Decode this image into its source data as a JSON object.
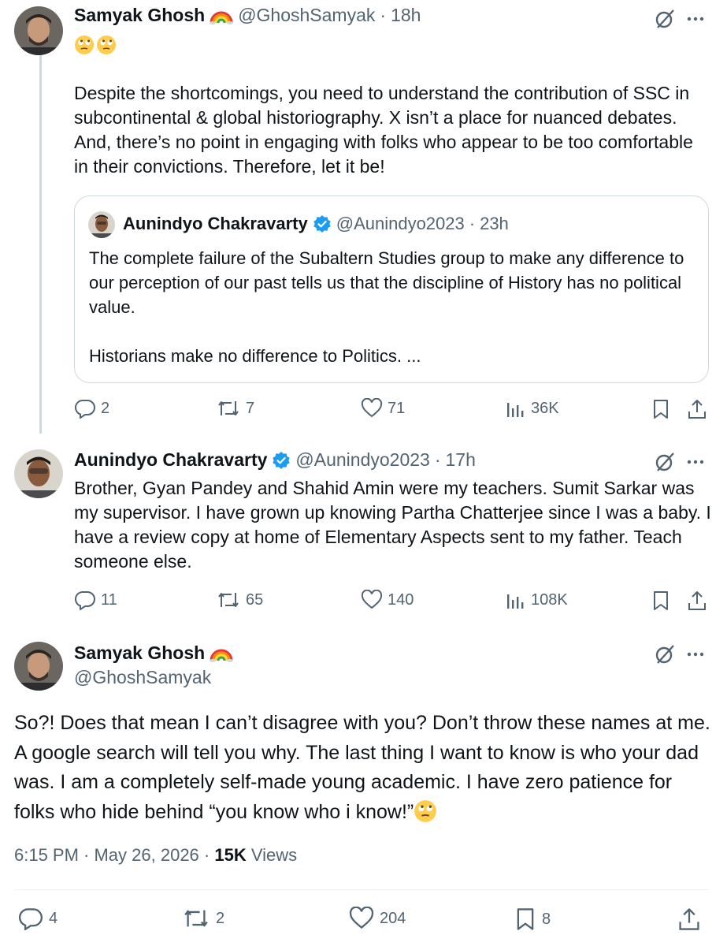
{
  "tweet1": {
    "name": "Samyak Ghosh",
    "handle": "@GhoshSamyak",
    "dot": "·",
    "time": "18h",
    "body": "Despite the shortcomings, you need to understand the contribution of SSC in subcontinental & global historiography. X isn’t a place for nuanced debates. And, there’s no point in engaging with folks who appear to be too comfortable in their convictions. Therefore, let it be!",
    "quote": {
      "name": "Aunindyo Chakravarty",
      "handle": "@Aunindyo2023",
      "dot": "·",
      "time": "23h",
      "para1": "The complete failure of the Subaltern Studies group to make any difference to our perception of our past tells us that the discipline of History has no political value.",
      "para2": "Historians make no difference to Politics. ..."
    },
    "replies": "2",
    "reposts": "7",
    "likes": "71",
    "views": "36K"
  },
  "tweet2": {
    "name": "Aunindyo Chakravarty",
    "handle": "@Aunindyo2023",
    "dot": "·",
    "time": "17h",
    "body": "Brother, Gyan Pandey and Shahid Amin were my teachers. Sumit Sarkar was my supervisor. I have grown up knowing Partha Chatterjee since I was a baby. I have a review copy at home of Elementary Aspects sent to my father. Teach someone else.",
    "replies": "11",
    "reposts": "65",
    "likes": "140",
    "views": "108K"
  },
  "tweet3": {
    "name": "Samyak Ghosh",
    "handle": "@GhoshSamyak",
    "body": "So?! Does that mean I can’t disagree with you? Don’t throw these names at me. A google search will tell you why. The last thing I want to know is who your dad was. I am a completely self-made young academic. I have zero patience for folks who hide behind “you know who i know!”",
    "timestamp": "6:15 PM · May 26, 2026 ·",
    "views_count": "15K",
    "views_label": "Views",
    "replies": "4",
    "reposts": "2",
    "likes": "204",
    "bookmarks": "8"
  },
  "colors": {
    "text": "#0f1419",
    "muted": "#536471",
    "border": "#cfd9de",
    "verified": "#1d9bf0"
  },
  "icons": [
    "rainbow-emoji",
    "rolling-eyes-emoji",
    "verified-badge-icon",
    "grok-icon",
    "more-icon",
    "reply-icon",
    "repost-icon",
    "like-icon",
    "views-icon",
    "bookmark-icon",
    "share-icon"
  ]
}
